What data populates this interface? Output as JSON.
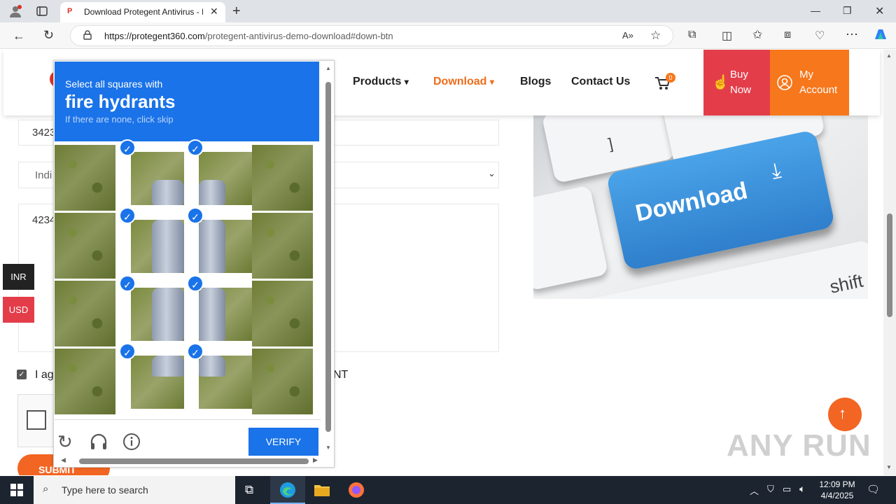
{
  "browser": {
    "tab_title": "Download Protegent Antivirus - F",
    "tab_favicon": "P",
    "url_domain": "https://protegent360.com",
    "url_path": "/protegent-antivirus-demo-download#down-btn",
    "new_tab": "+"
  },
  "nav": {
    "products": "Products",
    "download": "Download",
    "blogs": "Blogs",
    "contact": "Contact Us",
    "cart_count": "0",
    "buy_now_line1": "Buy",
    "buy_now_line2": "Now",
    "my_account_line1": "My",
    "my_account_line2": "Account"
  },
  "form": {
    "field1_value": "3423",
    "select_value": "Indi",
    "textarea_value": "4234",
    "agree_text_start": "I ag",
    "agree_text_end": "NT",
    "submit_label": "SUBMIT"
  },
  "currency": {
    "inr": "INR",
    "usd": "USD"
  },
  "hero": {
    "key_text": "Download",
    "key_label_1": "]",
    "key_label_2": "shift"
  },
  "captcha": {
    "prompt": "Select all squares with",
    "target": "fire hydrants",
    "hint": "If there are none, click skip",
    "verify_label": "VERIFY",
    "selected_tiles": [
      1,
      2,
      5,
      6,
      9,
      10,
      13,
      14
    ]
  },
  "taskbar": {
    "search_placeholder": "Type here to search",
    "time": "12:09 PM",
    "date": "4/4/2025"
  },
  "watermark": "ANY RUN",
  "colors": {
    "captcha_blue": "#1a73e8",
    "buy_now_red": "#e43d4a",
    "account_orange": "#f7771c",
    "download_orange": "#ef6c1a"
  }
}
